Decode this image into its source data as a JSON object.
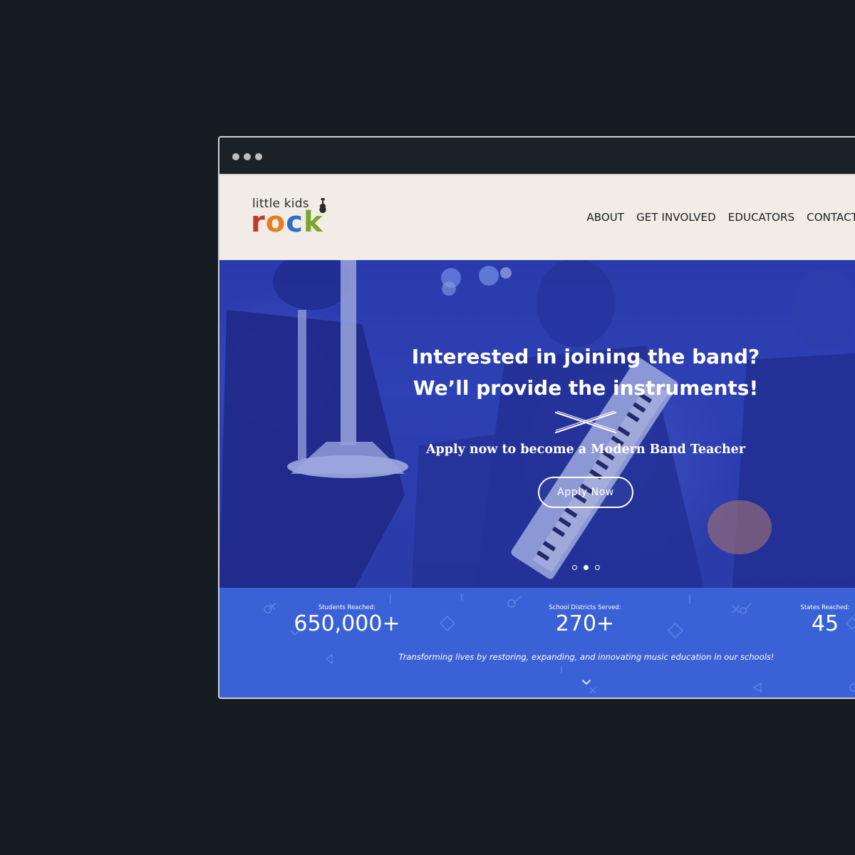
{
  "colors": {
    "backdrop": "#141c21",
    "header_bg": "#f1ede6",
    "hero_tint": "#2f43b5",
    "stats_bg": "#3a62d6",
    "logo_r": "#c0392b",
    "logo_o": "#e67e22",
    "logo_c": "#2e6fbf",
    "logo_k": "#7aa52e"
  },
  "logo": {
    "top": "little kids",
    "letters": [
      "r",
      "o",
      "c",
      "k"
    ]
  },
  "nav": {
    "items": [
      "ABOUT",
      "GET INVOLVED",
      "EDUCATORS",
      "CONTACT"
    ]
  },
  "hero": {
    "title_line1": "Interested in joining the band?",
    "title_line2": "We’ll provide the instruments!",
    "subtitle": "Apply now to become a Modern Band Teacher",
    "button_label": "Apply  Now",
    "slides": 3,
    "active_slide": 2
  },
  "stats": {
    "items": [
      {
        "label": "Students Reached:",
        "value": "650,000+"
      },
      {
        "label": "School Districts Served:",
        "value": "270+"
      },
      {
        "label": "States Reached:",
        "value": "45"
      }
    ],
    "tagline": "Transforming lives by restoring, expanding, and innovating music education in our schools!"
  },
  "icons": {
    "scroll_down": "chevron-down-icon",
    "logo_guitar": "guitar-icon",
    "divider": "drumsticks-icon"
  }
}
